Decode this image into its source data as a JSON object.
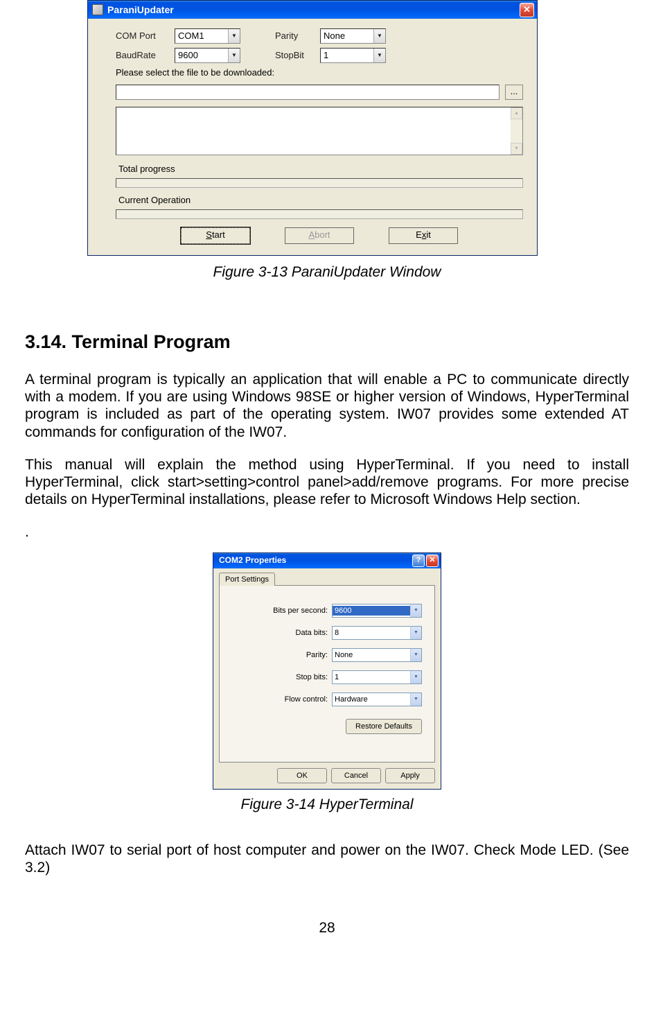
{
  "parani": {
    "title": "ParaniUpdater",
    "labels": {
      "comport": "COM Port",
      "baudrate": "BaudRate",
      "parity": "Parity",
      "stopbit": "StopBit",
      "prompt": "Please select the file to be downloaded:",
      "browse": "...",
      "total_progress": "Total progress",
      "current_op": "Current Operation"
    },
    "values": {
      "comport": "COM1",
      "baudrate": "9600",
      "parity": "None",
      "stopbit": "1"
    },
    "buttons": {
      "start_pre": "",
      "start_ul": "S",
      "start_post": "tart",
      "abort_pre": "",
      "abort_ul": "A",
      "abort_post": "bort",
      "exit_pre": "E",
      "exit_ul": "x",
      "exit_post": "it"
    }
  },
  "caption1": "Figure 3-13 ParaniUpdater Window",
  "section": {
    "heading": "3.14. Terminal Program",
    "p1": "A terminal program is typically an application that will enable a PC to communicate directly with a modem. If you are using Windows 98SE or higher version of Windows, HyperTerminal program is included as part of the operating system. IW07 provides some extended AT commands for configuration of the IW07.",
    "p2": "This manual will explain the method using HyperTerminal. If you need to install HyperTerminal, click start>setting>control panel>add/remove programs. For more precise details on HyperTerminal installations, please refer to Microsoft Windows Help section.",
    "orphan": "."
  },
  "com": {
    "title": "COM2 Properties",
    "tab": "Port Settings",
    "labels": {
      "bps": "Bits per second:",
      "databits": "Data bits:",
      "parity": "Parity:",
      "stopbits": "Stop bits:",
      "flow": "Flow control:"
    },
    "values": {
      "bps": "9600",
      "databits": "8",
      "parity": "None",
      "stopbits": "1",
      "flow": "Hardware"
    },
    "restore": "Restore Defaults",
    "ok": "OK",
    "cancel": "Cancel",
    "apply": "Apply"
  },
  "caption2": "Figure 3-14 HyperTerminal",
  "bottom": "Attach IW07 to serial port of host computer and power on the IW07. Check Mode LED. (See 3.2)",
  "page_number": "28"
}
